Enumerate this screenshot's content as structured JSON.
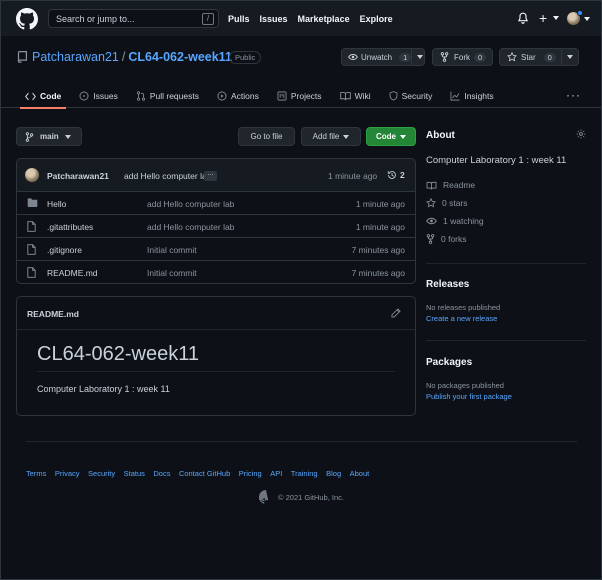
{
  "header": {
    "search_placeholder": "Search or jump to...",
    "search_key": "/",
    "nav": [
      "Pulls",
      "Issues",
      "Marketplace",
      "Explore"
    ],
    "plus": "+"
  },
  "repo": {
    "owner": "Patcharawan21",
    "separator": "/",
    "name": "CL64-062-week11",
    "visibility": "Public",
    "unwatch_label": "Unwatch",
    "watch_count": "1",
    "fork_label": "Fork",
    "fork_count": "0",
    "star_label": "Star",
    "star_count": "0"
  },
  "tabs": [
    {
      "label": "Code",
      "icon": "code-icon"
    },
    {
      "label": "Issues",
      "icon": "issue-icon"
    },
    {
      "label": "Pull requests",
      "icon": "pull-request-icon"
    },
    {
      "label": "Actions",
      "icon": "play-icon"
    },
    {
      "label": "Projects",
      "icon": "project-icon"
    },
    {
      "label": "Wiki",
      "icon": "book-icon"
    },
    {
      "label": "Security",
      "icon": "shield-icon"
    },
    {
      "label": "Insights",
      "icon": "graph-icon"
    }
  ],
  "toolbar": {
    "branch": "main",
    "go_to_file": "Go to file",
    "add_file": "Add file",
    "code": "Code"
  },
  "latest_commit": {
    "author": "Patcharawan21",
    "message": "add Hello computer lab",
    "ellipsis": "…",
    "time": "1 minute ago",
    "history_count": "2"
  },
  "files": [
    {
      "name": "Hello",
      "type": "folder",
      "message": "add Hello computer lab",
      "time": "1 minute ago"
    },
    {
      "name": ".gitattributes",
      "type": "file",
      "message": "add Hello computer lab",
      "time": "1 minute ago"
    },
    {
      "name": ".gitignore",
      "type": "file",
      "message": "Initial commit",
      "time": "7 minutes ago"
    },
    {
      "name": "README.md",
      "type": "file",
      "message": "Initial commit",
      "time": "7 minutes ago"
    }
  ],
  "readme": {
    "filename": "README.md",
    "heading": "CL64-062-week11",
    "body": "Computer Laboratory 1 : week 11"
  },
  "about": {
    "title": "About",
    "description": "Computer Laboratory 1 : week 11",
    "readme": "Readme",
    "stars": "0 stars",
    "watching": "1 watching",
    "forks": "0 forks"
  },
  "releases": {
    "title": "Releases",
    "empty": "No releases published",
    "link": "Create a new release"
  },
  "packages": {
    "title": "Packages",
    "empty": "No packages published",
    "link": "Publish your first package"
  },
  "footer": {
    "links": [
      "Terms",
      "Privacy",
      "Security",
      "Status",
      "Docs",
      "Contact GitHub",
      "Pricing",
      "API",
      "Training",
      "Blog",
      "About"
    ],
    "copyright": "© 2021 GitHub, Inc."
  },
  "colors": {
    "background": "#0d1117",
    "header": "#161b22",
    "link": "#58a6ff",
    "primary_button": "#238636",
    "active_tab": "#f78166",
    "border": "#30363d"
  }
}
